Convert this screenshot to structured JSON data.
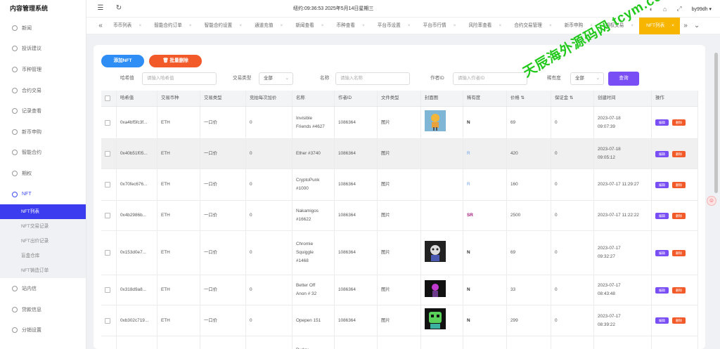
{
  "app_title": "内容管理系统",
  "sidebar": {
    "items": [
      {
        "label": "新闻",
        "icon": "news-icon"
      },
      {
        "label": "投诉建议",
        "icon": "feedback-icon"
      },
      {
        "label": "币种管理",
        "icon": "coin-icon"
      },
      {
        "label": "合约交易",
        "icon": "contract-icon"
      },
      {
        "label": "记录查看",
        "icon": "record-icon"
      },
      {
        "label": "新币申购",
        "icon": "subscribe-icon"
      },
      {
        "label": "智能合约",
        "icon": "smart-contract-icon"
      },
      {
        "label": "期权",
        "icon": "option-icon"
      },
      {
        "label": "NFT",
        "icon": "nft-icon"
      }
    ],
    "nft_sub": [
      "NFT列表",
      "NFT交易记录",
      "NFT出价记录",
      "盲盒仓库",
      "NFT铸造订单"
    ],
    "bottom_items": [
      {
        "label": "站内信",
        "icon": "message-icon"
      },
      {
        "label": "贷款信息",
        "icon": "loan-icon"
      },
      {
        "label": "分销设置",
        "icon": "distribution-icon"
      }
    ]
  },
  "header": {
    "clock": "纽约:09:36:53 2025年5月14日星期三",
    "user": "by99dh",
    "menu_icon": "menu-fold-icon",
    "refresh_icon": "refresh-icon"
  },
  "tabs": [
    "币币列表",
    "智能合约订单",
    "智能合约设置",
    "通道充值",
    "新闻查看",
    "币种查看",
    "平台币设置",
    "平台币行情",
    "风险率查看",
    "合约交易管理",
    "新币申购",
    "期权交易",
    "NFT列表"
  ],
  "toolbar": {
    "add": "添加NFT",
    "batch_delete": "批量删除"
  },
  "filters": {
    "hash_label": "哈希值",
    "hash_placeholder": "请输入哈希值",
    "trade_type_label": "交易类型",
    "trade_type_value": "全部",
    "name_label": "名称",
    "name_placeholder": "请输入名称",
    "author_label": "作者ID",
    "author_placeholder": "请输入作者ID",
    "rarity_label": "稀有度",
    "rarity_value": "全部",
    "query": "查询"
  },
  "table": {
    "columns": [
      "哈希值",
      "交易币种",
      "交易类型",
      "竞拍每次加价",
      "名称",
      "作者ID",
      "文件类型",
      "封面图",
      "稀有度",
      "价格 ⇅",
      "保证金 ⇅",
      "创建时间",
      "操作"
    ],
    "edit_label": "编辑",
    "delete_label": "删除",
    "rows": [
      {
        "hash": "0xa4bf5fc3f...",
        "coin": "ETH",
        "type": "一口价",
        "inc": "0",
        "name": [
          "Invisible",
          "Friends #4627"
        ],
        "author": "1086364",
        "file": "图片",
        "cover": "friends",
        "rarity": "N",
        "price": "69",
        "deposit": "0",
        "time": [
          "2023-07-18",
          "09:07:39"
        ]
      },
      {
        "hash": "0x40b51f05...",
        "coin": "ETH",
        "type": "一口价",
        "inc": "0",
        "name": [
          "Ether #3740"
        ],
        "author": "1086364",
        "file": "图片",
        "cover": "",
        "rarity": "R",
        "price": "420",
        "deposit": "0",
        "time": [
          "2023-07-18",
          "09:05:12"
        ]
      },
      {
        "hash": "0x70fec676...",
        "coin": "ETH",
        "type": "一口价",
        "inc": "0",
        "name": [
          "CryptoPunk",
          "#1000"
        ],
        "author": "1086364",
        "file": "图片",
        "cover": "",
        "rarity": "R",
        "price": "160",
        "deposit": "0",
        "time": [
          "2023-07-17 11:29:27"
        ]
      },
      {
        "hash": "0x4b2986b...",
        "coin": "ETH",
        "type": "一口价",
        "inc": "0",
        "name": [
          "Nakamigos",
          "#16622"
        ],
        "author": "1086364",
        "file": "图片",
        "cover": "",
        "rarity": "SR",
        "price": "2500",
        "deposit": "0",
        "time": [
          "2023-07-17 11:22:22"
        ]
      },
      {
        "hash": "0x153d0e7...",
        "coin": "ETH",
        "type": "一口价",
        "inc": "0",
        "name": [
          "Chromie",
          "Squiggle",
          "#1468"
        ],
        "author": "1086364",
        "file": "图片",
        "cover": "squiggle",
        "rarity": "N",
        "price": "69",
        "deposit": "0",
        "time": [
          "2023-07-17",
          "09:32:27"
        ]
      },
      {
        "hash": "0x318d9a8...",
        "coin": "ETH",
        "type": "一口价",
        "inc": "0",
        "name": [
          "Better Off",
          "Anon # 32"
        ],
        "author": "1086364",
        "file": "图片",
        "cover": "anon",
        "rarity": "N",
        "price": "33",
        "deposit": "0",
        "time": [
          "2023-07-17",
          "08:43:48"
        ]
      },
      {
        "hash": "0xb302c719...",
        "coin": "ETH",
        "type": "一口价",
        "inc": "0",
        "name": [
          "Opepen 151"
        ],
        "author": "1086364",
        "file": "图片",
        "cover": "opepen",
        "rarity": "N",
        "price": "299",
        "deposit": "0",
        "time": [
          "2023-07-17",
          "08:39:22"
        ]
      },
      {
        "hash": "",
        "coin": "",
        "type": "",
        "inc": "",
        "name": [
          "Pudgy"
        ],
        "author": "",
        "file": "",
        "cover": "",
        "rarity": "",
        "price": "",
        "deposit": "",
        "time": [
          ""
        ]
      }
    ]
  },
  "watermark": "天辰海外源码网 tcym.cc",
  "colors": {
    "primary": "#3b3bf0",
    "add": "#2f8ef5",
    "delete": "#f25a2a",
    "query": "#7a4ef5",
    "active_tab": "#f7b500",
    "watermark": "#22c91c"
  }
}
